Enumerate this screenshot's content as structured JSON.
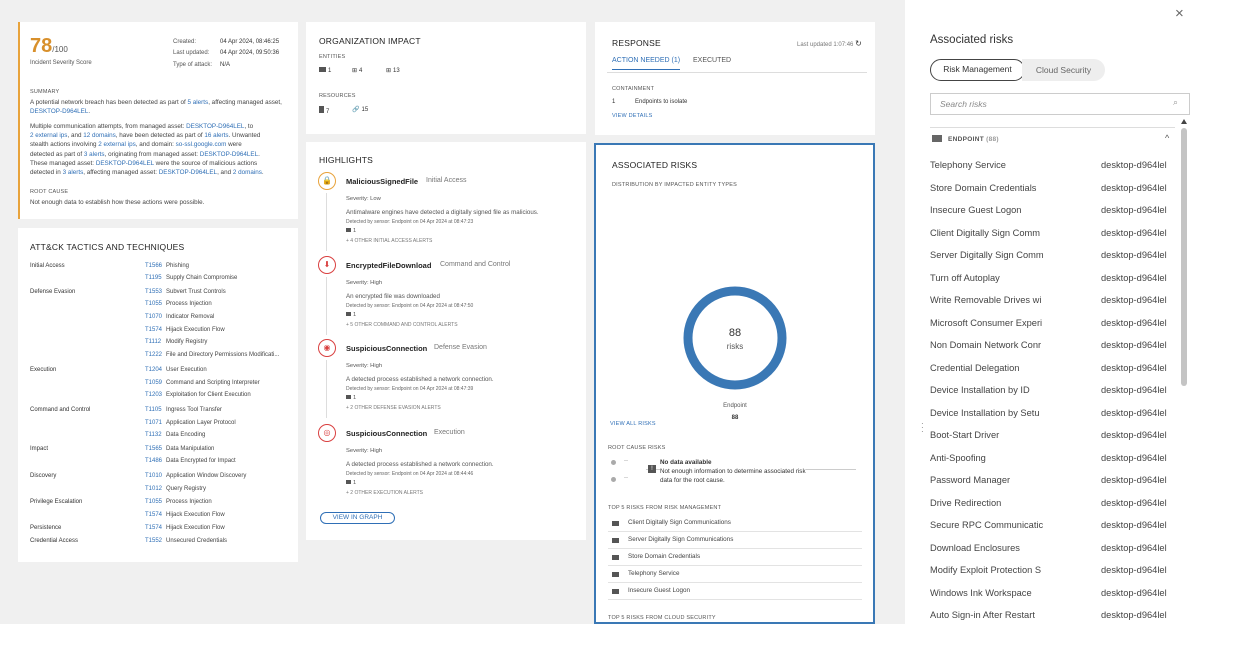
{
  "score": {
    "value": "78",
    "max": "/100",
    "label": "Incident Severity Score",
    "created_label": "Created:",
    "created": "04 Apr 2024, 08:46:25",
    "updated_label": "Last updated:",
    "updated": "04 Apr 2024, 09:50:36",
    "type_label": "Type of attack:",
    "type": "N/A"
  },
  "summary": {
    "title": "SUMMARY",
    "p1a": "A potential network breach has been detected as part of",
    "p1_link": "5 alerts",
    "p1b": ", affecting managed asset,",
    "p1_asset": "DESKTOP-D964LEL",
    "p1c": ".",
    "p2": [
      [
        {
          "t": "Multiple communication attempts, from managed asset: "
        },
        {
          "t": "DESKTOP-D964LEL",
          "l": 1
        },
        {
          "t": ", to"
        }
      ],
      [
        {
          "t": "2 external ips",
          "l": 1
        },
        {
          "t": ", and "
        },
        {
          "t": "12 domains",
          "l": 1
        },
        {
          "t": ", have been detected as part of "
        },
        {
          "t": "16 alerts",
          "l": 1
        },
        {
          "t": ". Unwanted"
        }
      ],
      [
        {
          "t": "stealth actions involving "
        },
        {
          "t": "2 external ips",
          "l": 1
        },
        {
          "t": ", and domain: "
        },
        {
          "t": "so-ssl.google.com",
          "l": 1
        },
        {
          "t": " were"
        }
      ],
      [
        {
          "t": "detected as part of "
        },
        {
          "t": "3 alerts",
          "l": 1
        },
        {
          "t": ", originating from managed asset: "
        },
        {
          "t": "DESKTOP-D964LEL",
          "l": 1
        },
        {
          "t": "."
        }
      ],
      [
        {
          "t": "These managed asset: "
        },
        {
          "t": "DESKTOP-D964LEL",
          "l": 1
        },
        {
          "t": " were the source of malicious actions"
        }
      ],
      [
        {
          "t": "detected in "
        },
        {
          "t": "3 alerts",
          "l": 1
        },
        {
          "t": ", affecting managed asset: "
        },
        {
          "t": "DESKTOP-D964LEL",
          "l": 1
        },
        {
          "t": ", and "
        },
        {
          "t": "2 domains",
          "l": 1
        },
        {
          "t": "."
        }
      ]
    ],
    "root_title": "ROOT CAUSE",
    "root_text": "Not enough data to establish how these actions were possible."
  },
  "attck": {
    "title": "ATT&CK TACTICS AND TECHNIQUES",
    "rows": [
      {
        "tactic": "Initial Access",
        "id": "T1566",
        "name": "Phishing"
      },
      {
        "tactic": "",
        "id": "T1195",
        "name": "Supply Chain Compromise"
      },
      {
        "tactic": "Defense Evasion",
        "id": "T1553",
        "name": "Subvert Trust Controls"
      },
      {
        "tactic": "",
        "id": "T1055",
        "name": "Process Injection"
      },
      {
        "tactic": "",
        "id": "T1070",
        "name": "Indicator Removal"
      },
      {
        "tactic": "",
        "id": "T1574",
        "name": "Hijack Execution Flow"
      },
      {
        "tactic": "",
        "id": "T1112",
        "name": "Modify Registry"
      },
      {
        "tactic": "",
        "id": "T1222",
        "name": "File and Directory Permissions Modificati..."
      },
      {
        "tactic": "Execution",
        "id": "T1204",
        "name": "User Execution"
      },
      {
        "tactic": "",
        "id": "T1059",
        "name": "Command and Scripting Interpreter"
      },
      {
        "tactic": "",
        "id": "T1203",
        "name": "Exploitation for Client Execution"
      },
      {
        "tactic": "Command and Control",
        "id": "T1105",
        "name": "Ingress Tool Transfer"
      },
      {
        "tactic": "",
        "id": "T1071",
        "name": "Application Layer Protocol"
      },
      {
        "tactic": "",
        "id": "T1132",
        "name": "Data Encoding"
      },
      {
        "tactic": "Impact",
        "id": "T1565",
        "name": "Data Manipulation"
      },
      {
        "tactic": "",
        "id": "T1486",
        "name": "Data Encrypted for Impact"
      },
      {
        "tactic": "Discovery",
        "id": "T1010",
        "name": "Application Window Discovery"
      },
      {
        "tactic": "",
        "id": "T1012",
        "name": "Query Registry"
      },
      {
        "tactic": "Privilege Escalation",
        "id": "T1055",
        "name": "Process Injection"
      },
      {
        "tactic": "",
        "id": "T1574",
        "name": "Hijack Execution Flow"
      },
      {
        "tactic": "Persistence",
        "id": "T1574",
        "name": "Hijack Execution Flow"
      },
      {
        "tactic": "Credential Access",
        "id": "T1552",
        "name": "Unsecured Credentials"
      }
    ]
  },
  "org": {
    "title": "ORGANIZATION IMPACT",
    "entities_label": "ENTITIES",
    "e1": "1",
    "e2": "4",
    "e3": "13",
    "resources_label": "RESOURCES",
    "r1": "7",
    "r2": "15"
  },
  "highlights": {
    "title": "HIGHLIGHTS",
    "items": [
      {
        "icon": "lock-icon",
        "color": "#e8a33c",
        "name": "MaliciousSignedFile",
        "tactic": "Initial Access",
        "severity": "Severity:  Low",
        "desc": "Antimalware engines have detected a digitally signed file as malicious.",
        "sensor": "Detected by sensor: Endpoint on 04 Apr 2024 at 08:47:23",
        "count": "1",
        "more": "+ 4 OTHER INITIAL ACCESS ALERTS"
      },
      {
        "icon": "download-icon",
        "color": "#d94040",
        "name": "EncryptedFileDownload",
        "tactic": "Command and Control",
        "severity": "Severity:  High",
        "desc": "An encrypted file was downloaded",
        "sensor": "Detected by sensor: Endpoint on 04 Apr 2024 at 08:47:50",
        "count": "1",
        "more": "+ 5 OTHER COMMAND AND CONTROL ALERTS"
      },
      {
        "icon": "mask-icon",
        "color": "#d94040",
        "name": "SuspiciousConnection",
        "tactic": "Defense Evasion",
        "severity": "Severity:  High",
        "desc": "A detected process established a network connection.",
        "sensor": "Detected by sensor: Endpoint on 04 Apr 2024 at 08:47:39",
        "count": "1",
        "more": "+ 2 OTHER DEFENSE EVASION ALERTS"
      },
      {
        "icon": "target-icon",
        "color": "#d94040",
        "name": "SuspiciousConnection",
        "tactic": "Execution",
        "severity": "Severity:  High",
        "desc": "A detected process established a network connection.",
        "sensor": "Detected by sensor: Endpoint on 04 Apr 2024 at 08:44:46",
        "count": "1",
        "more": "+ 2 OTHER EXECUTION ALERTS"
      }
    ],
    "view_graph": "VIEW IN GRAPH"
  },
  "response": {
    "title": "RESPONSE",
    "updated": "Last updated 1:07:46",
    "tab1": "ACTION NEEDED (1)",
    "tab2": "EXECUTED",
    "containment": "CONTAINMENT",
    "count": "1",
    "action": "Endpoints to isolate",
    "view_details": "VIEW DETAILS"
  },
  "assoc": {
    "title": "ASSOCIATED RISKS",
    "dist_label": "DISTRIBUTION BY IMPACTED ENTITY TYPES",
    "total": "88",
    "unit": "risks",
    "legend_label": "Endpoint",
    "legend_value": "88",
    "view_all": "VIEW ALL RISKS",
    "root_label": "ROOT CAUSE RISKS",
    "dash": "--",
    "no_data_title": "No data available",
    "no_data_text1": "Not enough information to determine associated risk",
    "no_data_text2": "data for the root cause.",
    "top_rm_label": "TOP 5 RISKS FROM RISK MANAGEMENT",
    "top_rm": [
      "Client Digitally Sign Communications",
      "Server Digitally Sign Communications",
      "Store Domain Credentials",
      "Telephony Service",
      "Insecure Guest Logon"
    ],
    "top_cs_label": "TOP 5 RISKS FROM CLOUD SECURITY",
    "ring_color": "#3a78b5"
  },
  "panel": {
    "title": "Associated risks",
    "tab1": "Risk Management",
    "tab2": "Cloud Security",
    "search_placeholder": "Search risks",
    "group": "ENDPOINT",
    "group_count": "(88)",
    "risks": [
      {
        "name": "Telephony Service",
        "host": "desktop-d964lel"
      },
      {
        "name": "Store Domain Credentials",
        "host": "desktop-d964lel"
      },
      {
        "name": "Insecure Guest Logon",
        "host": "desktop-d964lel"
      },
      {
        "name": "Client Digitally Sign Comm",
        "host": "desktop-d964lel"
      },
      {
        "name": "Server Digitally Sign Comm",
        "host": "desktop-d964lel"
      },
      {
        "name": "Turn off Autoplay",
        "host": "desktop-d964lel"
      },
      {
        "name": "Write Removable Drives wi",
        "host": "desktop-d964lel"
      },
      {
        "name": "Microsoft Consumer Experi",
        "host": "desktop-d964lel"
      },
      {
        "name": "Non Domain Network Conr",
        "host": "desktop-d964lel"
      },
      {
        "name": "Credential Delegation",
        "host": "desktop-d964lel"
      },
      {
        "name": "Device Installation by ID",
        "host": "desktop-d964lel"
      },
      {
        "name": "Device Installation by Setu",
        "host": "desktop-d964lel"
      },
      {
        "name": "Boot-Start Driver",
        "host": "desktop-d964lel"
      },
      {
        "name": "Anti-Spoofing",
        "host": "desktop-d964lel"
      },
      {
        "name": "Password Manager",
        "host": "desktop-d964lel"
      },
      {
        "name": "Drive Redirection",
        "host": "desktop-d964lel"
      },
      {
        "name": "Secure RPC Communicatic",
        "host": "desktop-d964lel"
      },
      {
        "name": "Download Enclosures",
        "host": "desktop-d964lel"
      },
      {
        "name": "Modify Exploit Protection S",
        "host": "desktop-d964lel"
      },
      {
        "name": "Windows Ink Workspace",
        "host": "desktop-d964lel"
      },
      {
        "name": "Auto Sign-in After Restart",
        "host": "desktop-d964lel"
      }
    ]
  }
}
